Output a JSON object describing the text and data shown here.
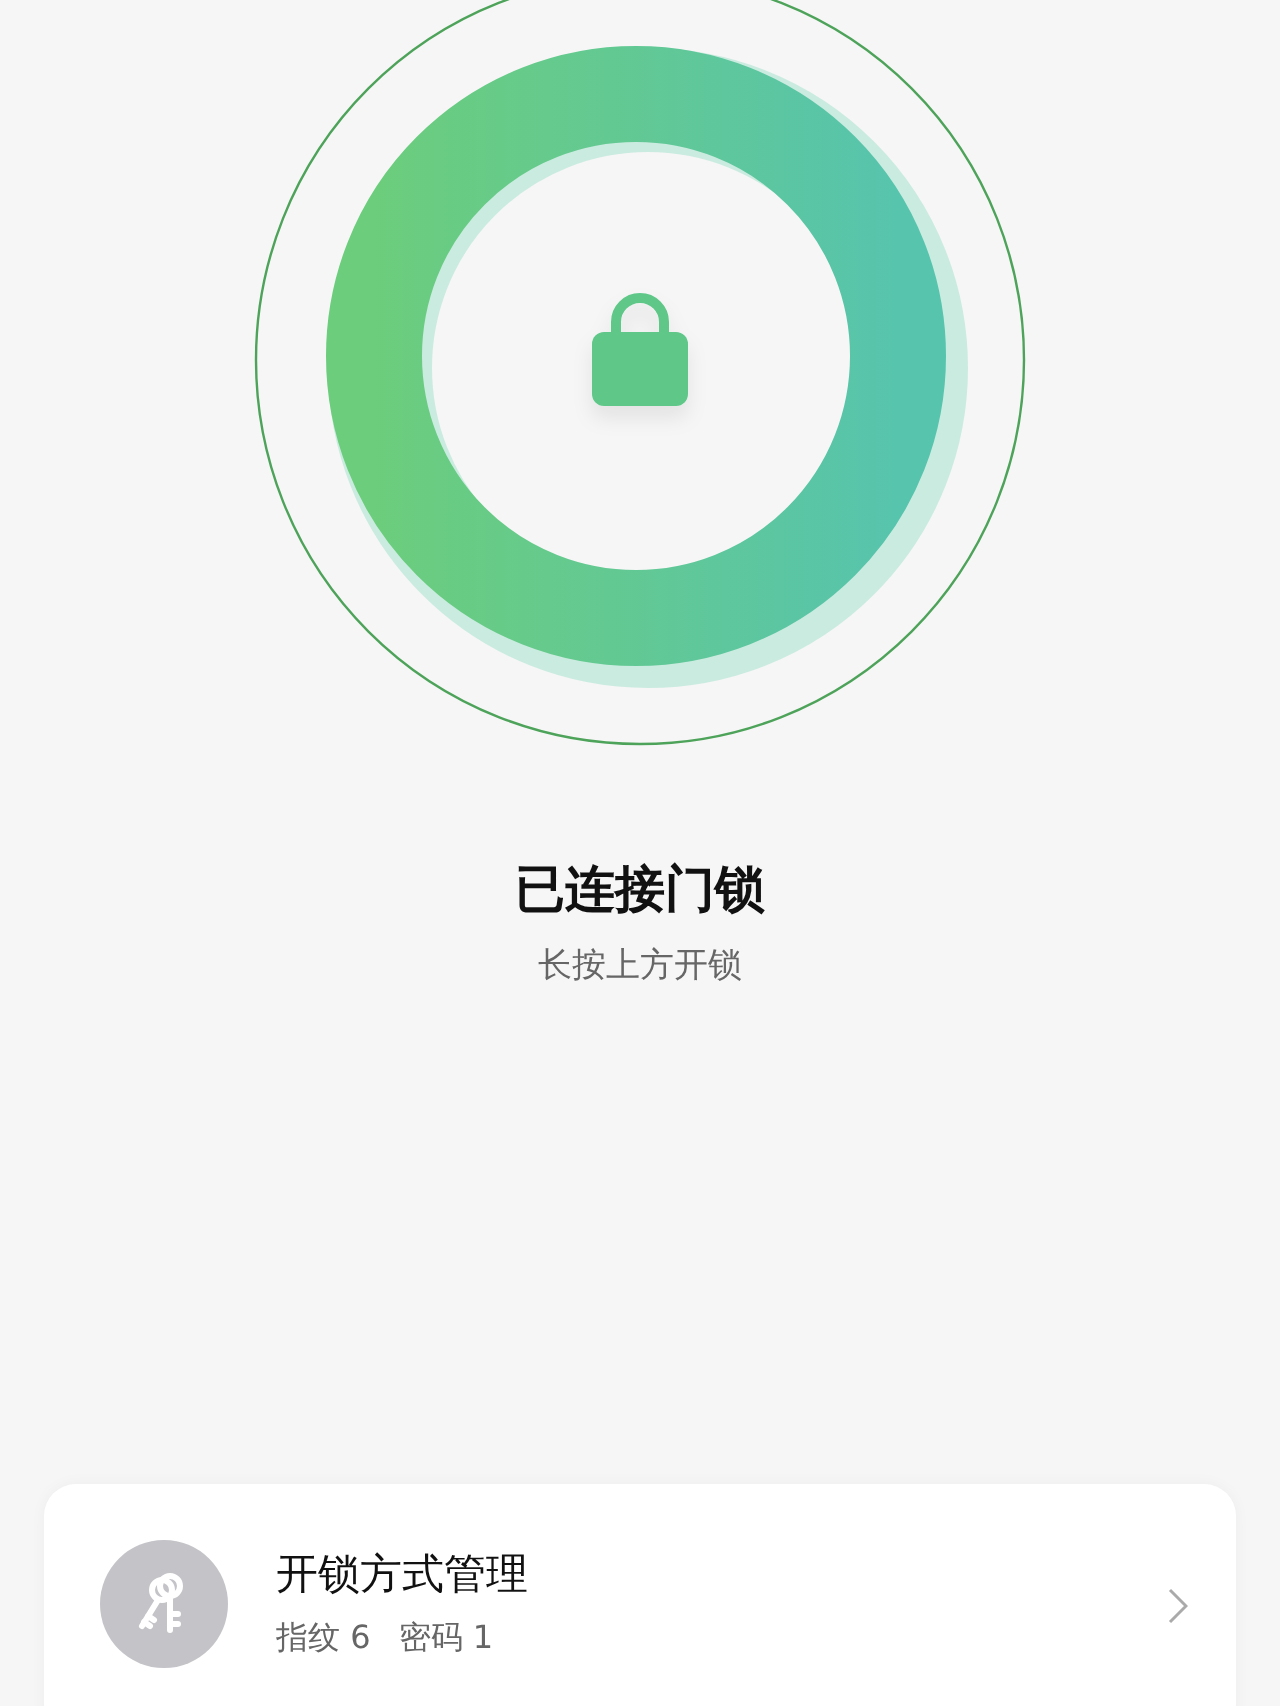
{
  "status": {
    "title": "已连接门锁",
    "hint": "长按上方开锁"
  },
  "method_card": {
    "title": "开锁方式管理",
    "details": [
      "指纹 6",
      "密码 1"
    ]
  }
}
